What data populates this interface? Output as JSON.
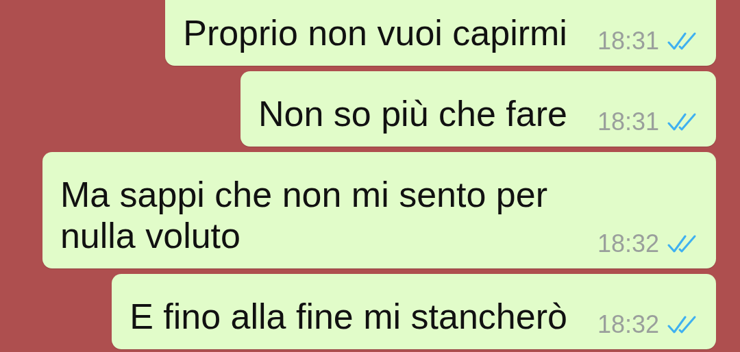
{
  "messages": [
    {
      "text": "Proprio non vuoi capirmi",
      "time": "18:31",
      "read": true
    },
    {
      "text": "Non so più che fare",
      "time": "18:31",
      "read": true
    },
    {
      "text": "Ma sappi che non mi sento per nulla voluto",
      "time": "18:32",
      "read": true
    },
    {
      "text": "E fino alla fine mi stancherò",
      "time": "18:32",
      "read": true
    }
  ]
}
